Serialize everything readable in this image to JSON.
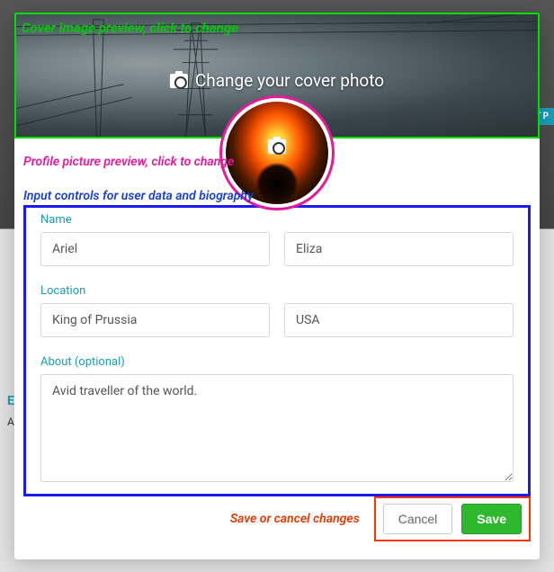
{
  "annotations": {
    "cover": "Cover image preview, click to change",
    "profile": "Profile picture preview, click to change",
    "form": "Input controls for user data and biography",
    "footer": "Save or cancel changes"
  },
  "cover": {
    "change_label": "Change your cover photo"
  },
  "form": {
    "name_label": "Name",
    "first_name": "Ariel",
    "last_name": "Eliza",
    "location_label": "Location",
    "city": "King of Prussia",
    "country": "USA",
    "about_label": "About (optional)",
    "about_value": "Avid traveller of the world."
  },
  "buttons": {
    "cancel": "Cancel",
    "save": "Save"
  },
  "background": {
    "side_button_fragment": "T P",
    "side_letter_1": "E",
    "side_letter_2": "A"
  }
}
